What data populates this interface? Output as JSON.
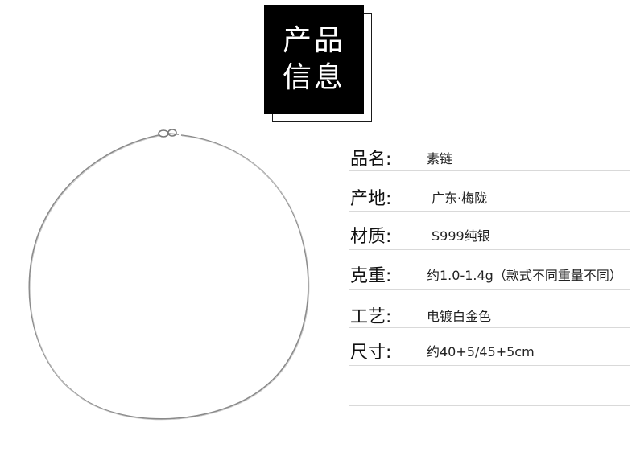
{
  "header": {
    "title_line1": "产品",
    "title_line2": "信息"
  },
  "product_image": {
    "icon": "silver-chain-necklace"
  },
  "info": [
    {
      "label": "品名:",
      "value": "素链"
    },
    {
      "label": "产地:",
      "value": "广东·梅陇"
    },
    {
      "label": "材质:",
      "value": "S999纯银"
    },
    {
      "label": "克重:",
      "value": "约1.0-1.4g（款式不同重量不同）"
    },
    {
      "label": "工艺:",
      "value": "电镀白金色"
    },
    {
      "label": "尺寸:",
      "value": "约40+5/45+5cm"
    }
  ],
  "colors": {
    "title_bg": "#000000",
    "title_text": "#ffffff",
    "rule": "#d9d9d9",
    "chain": "#8a8a8a"
  }
}
